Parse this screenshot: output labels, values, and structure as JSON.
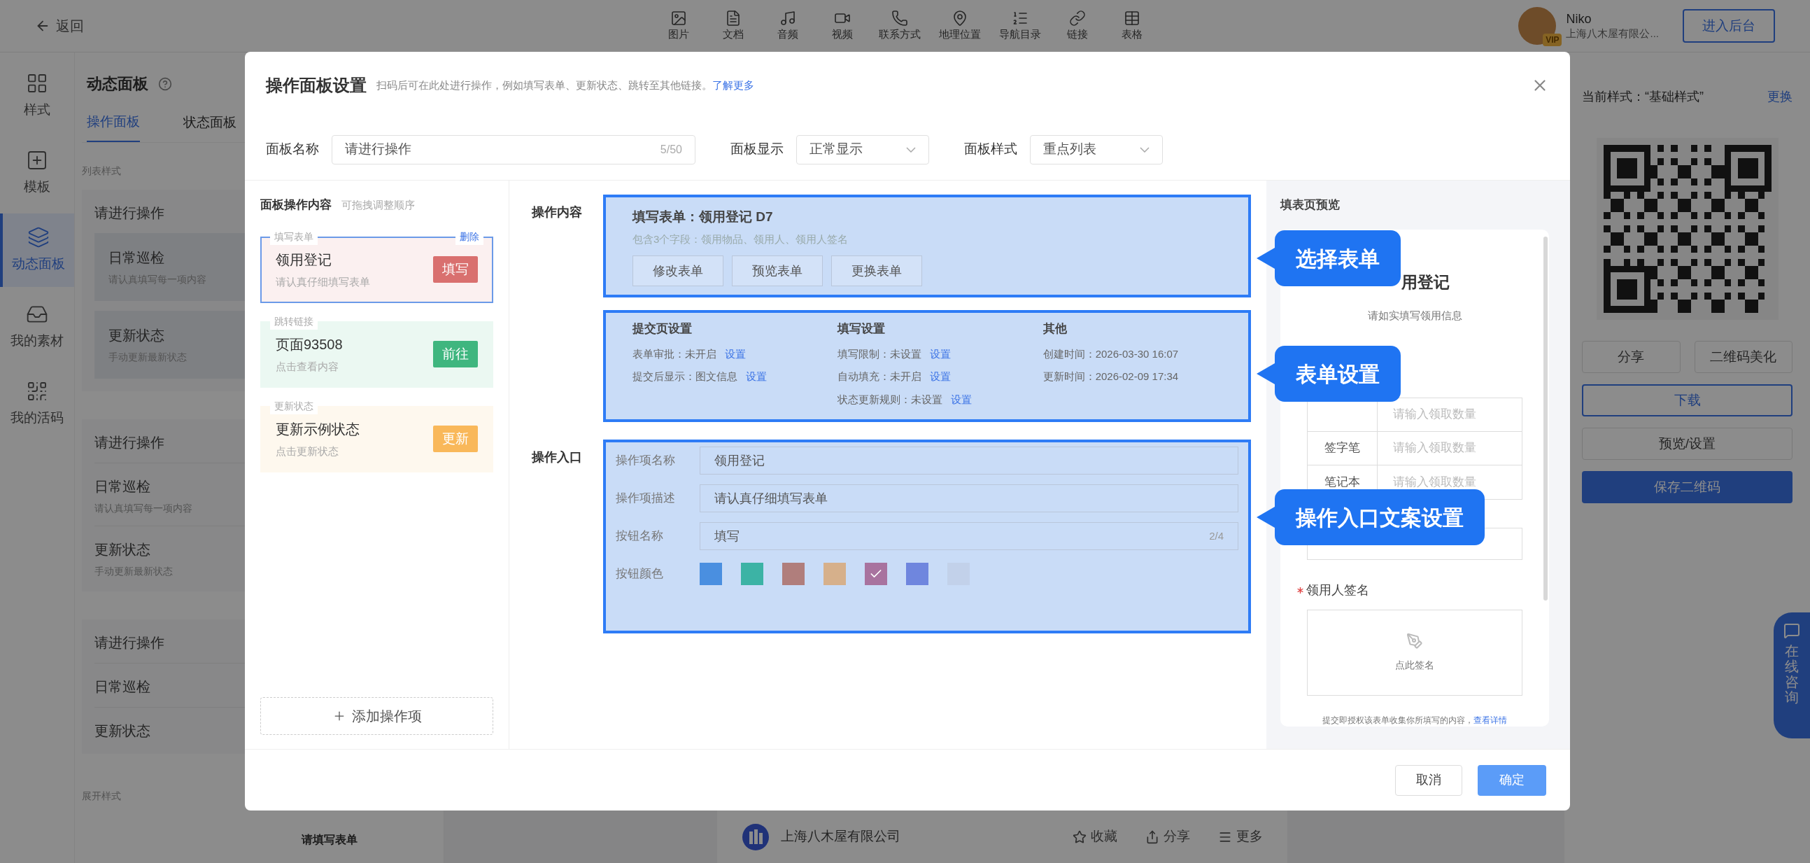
{
  "top_bar": {
    "back": "返回",
    "tools": [
      "图片",
      "文档",
      "音频",
      "视频",
      "联系方式",
      "地理位置",
      "导航目录",
      "链接",
      "表格"
    ],
    "user": {
      "name": "Niko",
      "badge": "VIP",
      "company": "上海八木屋有限公..."
    },
    "admin_button": "进入后台"
  },
  "sidebar": {
    "items": [
      {
        "label": "样式",
        "selected": false
      },
      {
        "label": "模板",
        "selected": false
      },
      {
        "label": "动态面板",
        "selected": true
      },
      {
        "label": "我的素材",
        "selected": false
      },
      {
        "label": "我的活码",
        "selected": false
      }
    ]
  },
  "panel": {
    "title": "动态面板",
    "tabs": [
      {
        "label": "操作面板",
        "selected": true
      },
      {
        "label": "状态面板",
        "selected": false
      }
    ],
    "list_style_label": "列表样式",
    "groups": [
      {
        "kind": "boxed",
        "title": "请进行操作",
        "items": [
          {
            "title": "日常巡检",
            "desc": "请认真填写每一项内容"
          },
          {
            "title": "更新状态",
            "desc": "手动更新最新状态"
          }
        ]
      },
      {
        "kind": "plain",
        "title": "请进行操作",
        "items": [
          {
            "title": "日常巡检",
            "desc": "请认真填写每一项内容"
          },
          {
            "title": "更新状态",
            "desc": "手动更新最新状态"
          }
        ]
      },
      {
        "kind": "plain",
        "title": "请进行操作",
        "items": [
          {
            "title": "日常巡检"
          },
          {
            "title": "更新状态"
          }
        ]
      }
    ],
    "expand_style_label": "展开样式",
    "form_title": "请填写表单"
  },
  "canvas": {
    "company": "上海八木屋有限公司",
    "actions": [
      "收藏",
      "分享",
      "更多"
    ]
  },
  "right_panel": {
    "current_style": "当前样式：“基础样式”",
    "change_link": "更换",
    "buttons": [
      {
        "label": "分享",
        "kind": "plain"
      },
      {
        "label": "二维码美化",
        "kind": "plain"
      },
      {
        "label": "下载",
        "kind": "outline"
      },
      {
        "label": "预览/设置",
        "kind": "plain"
      },
      {
        "label": "保存二维码",
        "kind": "primary"
      }
    ]
  },
  "consult": "在线咨询",
  "dialog": {
    "title": "操作面板设置",
    "subtitle": "扫码后可在此处进行操作，例如填写表单、更新状态、跳转至其他链接。",
    "learn_more": "了解更多",
    "panel_name": {
      "label": "面板名称",
      "value": "请进行操作",
      "counter": "5/50"
    },
    "panel_display": {
      "label": "面板显示",
      "value": "正常显示"
    },
    "panel_style": {
      "label": "面板样式",
      "value": "重点列表"
    },
    "actions_list": {
      "title": "面板操作内容",
      "hint": "可拖拽调整顺序",
      "delete": "删除",
      "add": "添加操作项",
      "items": [
        {
          "tag": "填写表单",
          "title": "领用登记",
          "desc": "请认真仔细填写表单",
          "button": "填写",
          "color": "#d9706f",
          "selected": true
        },
        {
          "tag": "跳转链接",
          "title": "页面93508",
          "desc": "点击查看内容",
          "button": "前往",
          "color": "#3fb67f",
          "selected": false
        },
        {
          "tag": "更新状态",
          "title": "更新示例状态",
          "desc": "点击更新状态",
          "button": "更新",
          "color": "#f9b85a",
          "selected": false
        }
      ]
    },
    "content": {
      "label": "操作内容",
      "form_title": "填写表单：领用登记 D7",
      "form_desc": "包含3个字段：领用物品、领用人、领用人签名",
      "form_buttons": [
        "修改表单",
        "预览表单",
        "更换表单"
      ],
      "settings": [
        {
          "title": "提交页设置",
          "rows": [
            {
              "text": "表单审批：未开启",
              "link": "设置"
            },
            {
              "text": "提交后显示：图文信息",
              "link": "设置"
            }
          ]
        },
        {
          "title": "填写设置",
          "rows": [
            {
              "text": "填写限制：未设置",
              "link": "设置"
            },
            {
              "text": "自动填充：未开启",
              "link": "设置"
            },
            {
              "text": "状态更新规则：未设置",
              "link": "设置"
            }
          ]
        },
        {
          "title": "其他",
          "rows": [
            {
              "text": "创建时间：2026-03-30 16:07"
            },
            {
              "text": "更新时间：2026-02-09 17:34"
            }
          ]
        }
      ]
    },
    "entry": {
      "label": "操作入口",
      "fields": [
        {
          "label": "操作项名称",
          "value": "领用登记"
        },
        {
          "label": "操作项描述",
          "value": "请认真仔细填写表单"
        },
        {
          "label": "按钮名称",
          "value": "填写",
          "counter": "2/4"
        }
      ],
      "color_label": "按钮颜色",
      "colors": [
        {
          "color": "#4a8fe0",
          "selected": false
        },
        {
          "color": "#3cb3a5",
          "selected": false
        },
        {
          "color": "#b07e7c",
          "selected": false
        },
        {
          "color": "#d6b08b",
          "selected": false
        },
        {
          "color": "#a8739f",
          "selected": true
        },
        {
          "color": "#6f86de",
          "selected": false
        },
        {
          "color": "#c2d1ea",
          "selected": false
        }
      ]
    },
    "preview": {
      "title": "填表页预览",
      "form_title": "用登记",
      "form_subtitle": "请如实填写领用信息",
      "rows": [
        {
          "placeholder": "请输入领取数量"
        },
        {
          "item": "签字笔",
          "placeholder": "请输入领取数量"
        },
        {
          "item": "笔记本",
          "placeholder": "请输入领取数量"
        }
      ],
      "signature": {
        "label": "领用人签名",
        "required": true,
        "hint": "点此签名"
      },
      "notice": "提交即授权该表单收集你所填写的内容，",
      "notice_link": "查看详情"
    },
    "callouts": [
      "选择表单",
      "表单设置",
      "操作入口文案设置"
    ],
    "footer": {
      "cancel": "取消",
      "confirm": "确定"
    }
  }
}
